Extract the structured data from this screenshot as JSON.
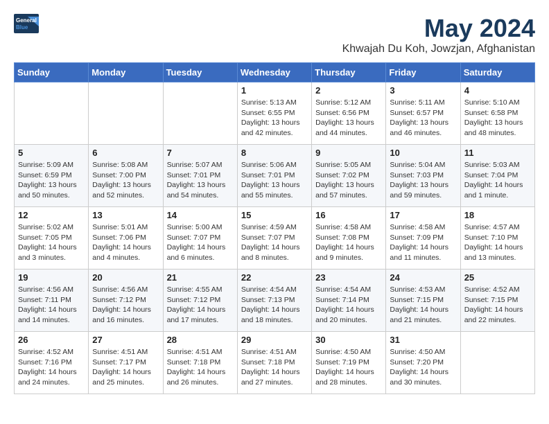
{
  "header": {
    "logo_general": "General",
    "logo_blue": "Blue",
    "month": "May 2024",
    "location": "Khwajah Du Koh, Jowzjan, Afghanistan"
  },
  "days_of_week": [
    "Sunday",
    "Monday",
    "Tuesday",
    "Wednesday",
    "Thursday",
    "Friday",
    "Saturday"
  ],
  "weeks": [
    [
      {
        "day": "",
        "info": ""
      },
      {
        "day": "",
        "info": ""
      },
      {
        "day": "",
        "info": ""
      },
      {
        "day": "1",
        "info": "Sunrise: 5:13 AM\nSunset: 6:55 PM\nDaylight: 13 hours\nand 42 minutes."
      },
      {
        "day": "2",
        "info": "Sunrise: 5:12 AM\nSunset: 6:56 PM\nDaylight: 13 hours\nand 44 minutes."
      },
      {
        "day": "3",
        "info": "Sunrise: 5:11 AM\nSunset: 6:57 PM\nDaylight: 13 hours\nand 46 minutes."
      },
      {
        "day": "4",
        "info": "Sunrise: 5:10 AM\nSunset: 6:58 PM\nDaylight: 13 hours\nand 48 minutes."
      }
    ],
    [
      {
        "day": "5",
        "info": "Sunrise: 5:09 AM\nSunset: 6:59 PM\nDaylight: 13 hours\nand 50 minutes."
      },
      {
        "day": "6",
        "info": "Sunrise: 5:08 AM\nSunset: 7:00 PM\nDaylight: 13 hours\nand 52 minutes."
      },
      {
        "day": "7",
        "info": "Sunrise: 5:07 AM\nSunset: 7:01 PM\nDaylight: 13 hours\nand 54 minutes."
      },
      {
        "day": "8",
        "info": "Sunrise: 5:06 AM\nSunset: 7:01 PM\nDaylight: 13 hours\nand 55 minutes."
      },
      {
        "day": "9",
        "info": "Sunrise: 5:05 AM\nSunset: 7:02 PM\nDaylight: 13 hours\nand 57 minutes."
      },
      {
        "day": "10",
        "info": "Sunrise: 5:04 AM\nSunset: 7:03 PM\nDaylight: 13 hours\nand 59 minutes."
      },
      {
        "day": "11",
        "info": "Sunrise: 5:03 AM\nSunset: 7:04 PM\nDaylight: 14 hours\nand 1 minute."
      }
    ],
    [
      {
        "day": "12",
        "info": "Sunrise: 5:02 AM\nSunset: 7:05 PM\nDaylight: 14 hours\nand 3 minutes."
      },
      {
        "day": "13",
        "info": "Sunrise: 5:01 AM\nSunset: 7:06 PM\nDaylight: 14 hours\nand 4 minutes."
      },
      {
        "day": "14",
        "info": "Sunrise: 5:00 AM\nSunset: 7:07 PM\nDaylight: 14 hours\nand 6 minutes."
      },
      {
        "day": "15",
        "info": "Sunrise: 4:59 AM\nSunset: 7:07 PM\nDaylight: 14 hours\nand 8 minutes."
      },
      {
        "day": "16",
        "info": "Sunrise: 4:58 AM\nSunset: 7:08 PM\nDaylight: 14 hours\nand 9 minutes."
      },
      {
        "day": "17",
        "info": "Sunrise: 4:58 AM\nSunset: 7:09 PM\nDaylight: 14 hours\nand 11 minutes."
      },
      {
        "day": "18",
        "info": "Sunrise: 4:57 AM\nSunset: 7:10 PM\nDaylight: 14 hours\nand 13 minutes."
      }
    ],
    [
      {
        "day": "19",
        "info": "Sunrise: 4:56 AM\nSunset: 7:11 PM\nDaylight: 14 hours\nand 14 minutes."
      },
      {
        "day": "20",
        "info": "Sunrise: 4:56 AM\nSunset: 7:12 PM\nDaylight: 14 hours\nand 16 minutes."
      },
      {
        "day": "21",
        "info": "Sunrise: 4:55 AM\nSunset: 7:12 PM\nDaylight: 14 hours\nand 17 minutes."
      },
      {
        "day": "22",
        "info": "Sunrise: 4:54 AM\nSunset: 7:13 PM\nDaylight: 14 hours\nand 18 minutes."
      },
      {
        "day": "23",
        "info": "Sunrise: 4:54 AM\nSunset: 7:14 PM\nDaylight: 14 hours\nand 20 minutes."
      },
      {
        "day": "24",
        "info": "Sunrise: 4:53 AM\nSunset: 7:15 PM\nDaylight: 14 hours\nand 21 minutes."
      },
      {
        "day": "25",
        "info": "Sunrise: 4:52 AM\nSunset: 7:15 PM\nDaylight: 14 hours\nand 22 minutes."
      }
    ],
    [
      {
        "day": "26",
        "info": "Sunrise: 4:52 AM\nSunset: 7:16 PM\nDaylight: 14 hours\nand 24 minutes."
      },
      {
        "day": "27",
        "info": "Sunrise: 4:51 AM\nSunset: 7:17 PM\nDaylight: 14 hours\nand 25 minutes."
      },
      {
        "day": "28",
        "info": "Sunrise: 4:51 AM\nSunset: 7:18 PM\nDaylight: 14 hours\nand 26 minutes."
      },
      {
        "day": "29",
        "info": "Sunrise: 4:51 AM\nSunset: 7:18 PM\nDaylight: 14 hours\nand 27 minutes."
      },
      {
        "day": "30",
        "info": "Sunrise: 4:50 AM\nSunset: 7:19 PM\nDaylight: 14 hours\nand 28 minutes."
      },
      {
        "day": "31",
        "info": "Sunrise: 4:50 AM\nSunset: 7:20 PM\nDaylight: 14 hours\nand 30 minutes."
      },
      {
        "day": "",
        "info": ""
      }
    ]
  ]
}
